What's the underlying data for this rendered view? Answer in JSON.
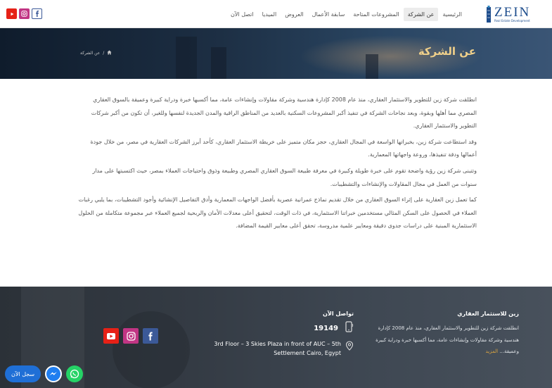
{
  "header": {
    "logo": {
      "word": "ZEIN",
      "tagline": "Real Estate Development"
    },
    "nav": [
      {
        "label": "الرئيسية",
        "active": false
      },
      {
        "label": "عن الشركة",
        "active": true
      },
      {
        "label": "المشروعات المتاحة",
        "active": false
      },
      {
        "label": "سابقة الأعمال",
        "active": false
      },
      {
        "label": "العروض",
        "active": false
      },
      {
        "label": "الميديا",
        "active": false
      },
      {
        "label": "اتصل الآن",
        "active": false
      }
    ],
    "social": [
      "facebook-icon",
      "instagram-icon",
      "youtube-icon"
    ]
  },
  "banner": {
    "title": "عن الشركة",
    "breadcrumb": {
      "home_icon": "home-icon",
      "separator": "/",
      "current": "عن الشركة"
    }
  },
  "content": {
    "paragraphs": [
      "انطلقت شركة زين للتطوير والاستثمار العقاري، منذ عام 2008 كإدارة هندسية وشركة مقاولات وإنشاءات عامة، مما أكسبها خبرة ودراية كبيرة وعميقة بالسوق العقاري المصري مما أهلها وبقوة، وبعد نجاحات الشركة في تنفيذ أكبر المشروعات السكنية بالعديد من المناطق الراقية والمدن الجديدة لنفسها وللغير، أن تكون من أكبر شركات التطوير والاستثمار العقاري.",
      "وقد استطاعت شركة زين، بخبراتها الواسعة في المجال العقاري، حجز مكان متميز على خريطة الاستثمار العقاري، كأحد أبرز الشركات العقارية في مصر، من خلال جودة أعمالها ودقة تنفيذها، وروعة واجهاتها المعمارية.",
      "وتتبنى شركة زين رؤية واضحة تقوم على خبرة طويلة وكبيرة في معرفة طبيعة السوق العقاري المصري وطبيعة وذوق واحتياجات العملاء بمصر، حيث اكتسبتها على مدار سنوات من العمل في مجال المقاولات والإنشاءات والتشطيبات.",
      "كما تعمل زين العقارية على إثراء السوق العقاري من خلال تقديم نماذج عمرانية عصرية بأفضل الواجهات المعمارية وأدق التفاصيل الإنشائية وأجود التشطيبات، بما يلبي رغبات العملاء في الحصول على السكن المثالي مستخدمين خبراتنا الاستثمارية، في ذات الوقت، لتحقيق أعلى معدلات الأمان والربحية لجميع العملاء عبر مجموعة متكاملة من الحلول الاستثمارية المبنية على دراسات جدوى دقيقة ومعايير علمية مدروسة، تحقق أعلى معايير القيمة المضافة."
    ]
  },
  "footer": {
    "about": {
      "title": "زين للاستثمار العقاري",
      "text": "انطلقت شركة زين للتطوير والاستثمار العقاري، منذ عام 2008 كإدارة هندسية وشركة مقاولات وإنشاءات عامة، مما أكسبها خبرة ودراية كبيرة وعميقة...",
      "more": "المزيد"
    },
    "contact": {
      "title": "تواصل الآن",
      "phone": "19149",
      "address": "3rd Floor – 3 Skies Plaza in front of AUC – 5th Settlement Cairo, Egypt"
    },
    "social": [
      "facebook-icon",
      "instagram-icon",
      "youtube-icon"
    ]
  },
  "floating": {
    "register_label": "سجل الآن",
    "messenger": "messenger-icon",
    "whatsapp": "whatsapp-icon"
  },
  "colors": {
    "brand_blue": "#1c4c8c",
    "banner_title": "#f0d08a",
    "youtube": "#e62117",
    "instagram": "#c13584",
    "facebook": "#3b5998",
    "whatsapp": "#25d366",
    "register_pill": "#1f6fd6",
    "more_link": "#d9a441"
  }
}
